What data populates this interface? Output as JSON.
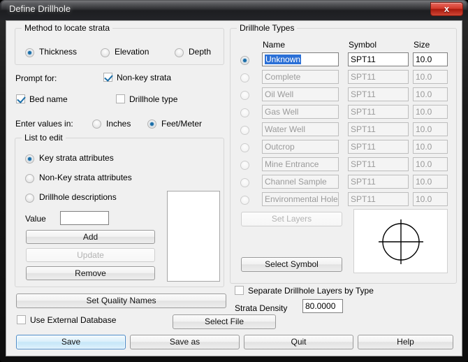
{
  "window": {
    "title": "Define Drillhole",
    "close_label": "x"
  },
  "method_group": {
    "legend": "Method to locate strata",
    "options": [
      {
        "label": "Thickness",
        "selected": true
      },
      {
        "label": "Elevation",
        "selected": false
      },
      {
        "label": "Depth",
        "selected": false
      }
    ]
  },
  "prompt": {
    "label": "Prompt for:",
    "checks": [
      {
        "label": "Non-key strata",
        "checked": true
      },
      {
        "label": "Bed name",
        "checked": true
      },
      {
        "label": "Drillhole type",
        "checked": false
      }
    ]
  },
  "units": {
    "label": "Enter values in:",
    "options": [
      {
        "label": "Inches",
        "selected": false
      },
      {
        "label": "Feet/Meter",
        "selected": true
      }
    ]
  },
  "list_to_edit": {
    "legend": "List to edit",
    "options": [
      {
        "label": "Key strata attributes",
        "selected": true
      },
      {
        "label": "Non-Key strata attributes",
        "selected": false
      },
      {
        "label": "Drillhole descriptions",
        "selected": false
      }
    ],
    "value_label": "Value",
    "value_text": "",
    "buttons": [
      {
        "label": "Add",
        "enabled": true
      },
      {
        "label": "Update",
        "enabled": false
      },
      {
        "label": "Remove",
        "enabled": true
      }
    ],
    "list_items": []
  },
  "quality": {
    "set_quality_names_label": "Set Quality Names",
    "use_external_db_label": "Use External Database",
    "use_external_db_checked": false
  },
  "drillhole_types": {
    "legend": "Drillhole Types",
    "columns": [
      "Name",
      "Symbol",
      "Size"
    ],
    "rows": [
      {
        "name": "Unknown",
        "symbol": "SPT11",
        "size": "10.0",
        "selected": true,
        "active": true
      },
      {
        "name": "Complete",
        "symbol": "SPT11",
        "size": "10.0",
        "selected": false,
        "active": false
      },
      {
        "name": "Oil Well",
        "symbol": "SPT11",
        "size": "10.0",
        "selected": false,
        "active": false
      },
      {
        "name": "Gas Well",
        "symbol": "SPT11",
        "size": "10.0",
        "selected": false,
        "active": false
      },
      {
        "name": "Water Well",
        "symbol": "SPT11",
        "size": "10.0",
        "selected": false,
        "active": false
      },
      {
        "name": "Outcrop",
        "symbol": "SPT11",
        "size": "10.0",
        "selected": false,
        "active": false
      },
      {
        "name": "Mine Entrance",
        "symbol": "SPT11",
        "size": "10.0",
        "selected": false,
        "active": false
      },
      {
        "name": "Channel Sample",
        "symbol": "SPT11",
        "size": "10.0",
        "selected": false,
        "active": false
      },
      {
        "name": "Environmental Hole",
        "symbol": "SPT11",
        "size": "10.0",
        "selected": false,
        "active": false
      }
    ],
    "set_layers_label": "Set Layers",
    "select_symbol_label": "Select Symbol",
    "symbol_preview_name": "circle-crosshair-symbol"
  },
  "separate_layers": {
    "label": "Separate Drillhole Layers by Type",
    "checked": false
  },
  "strata_density": {
    "label": "Strata Density",
    "value": "80.0000"
  },
  "select_file": {
    "label": "Select File"
  },
  "footer": {
    "buttons": [
      {
        "label": "Save",
        "default": true
      },
      {
        "label": "Save as",
        "default": false
      },
      {
        "label": "Quit",
        "default": false
      },
      {
        "label": "Help",
        "default": false
      }
    ]
  }
}
